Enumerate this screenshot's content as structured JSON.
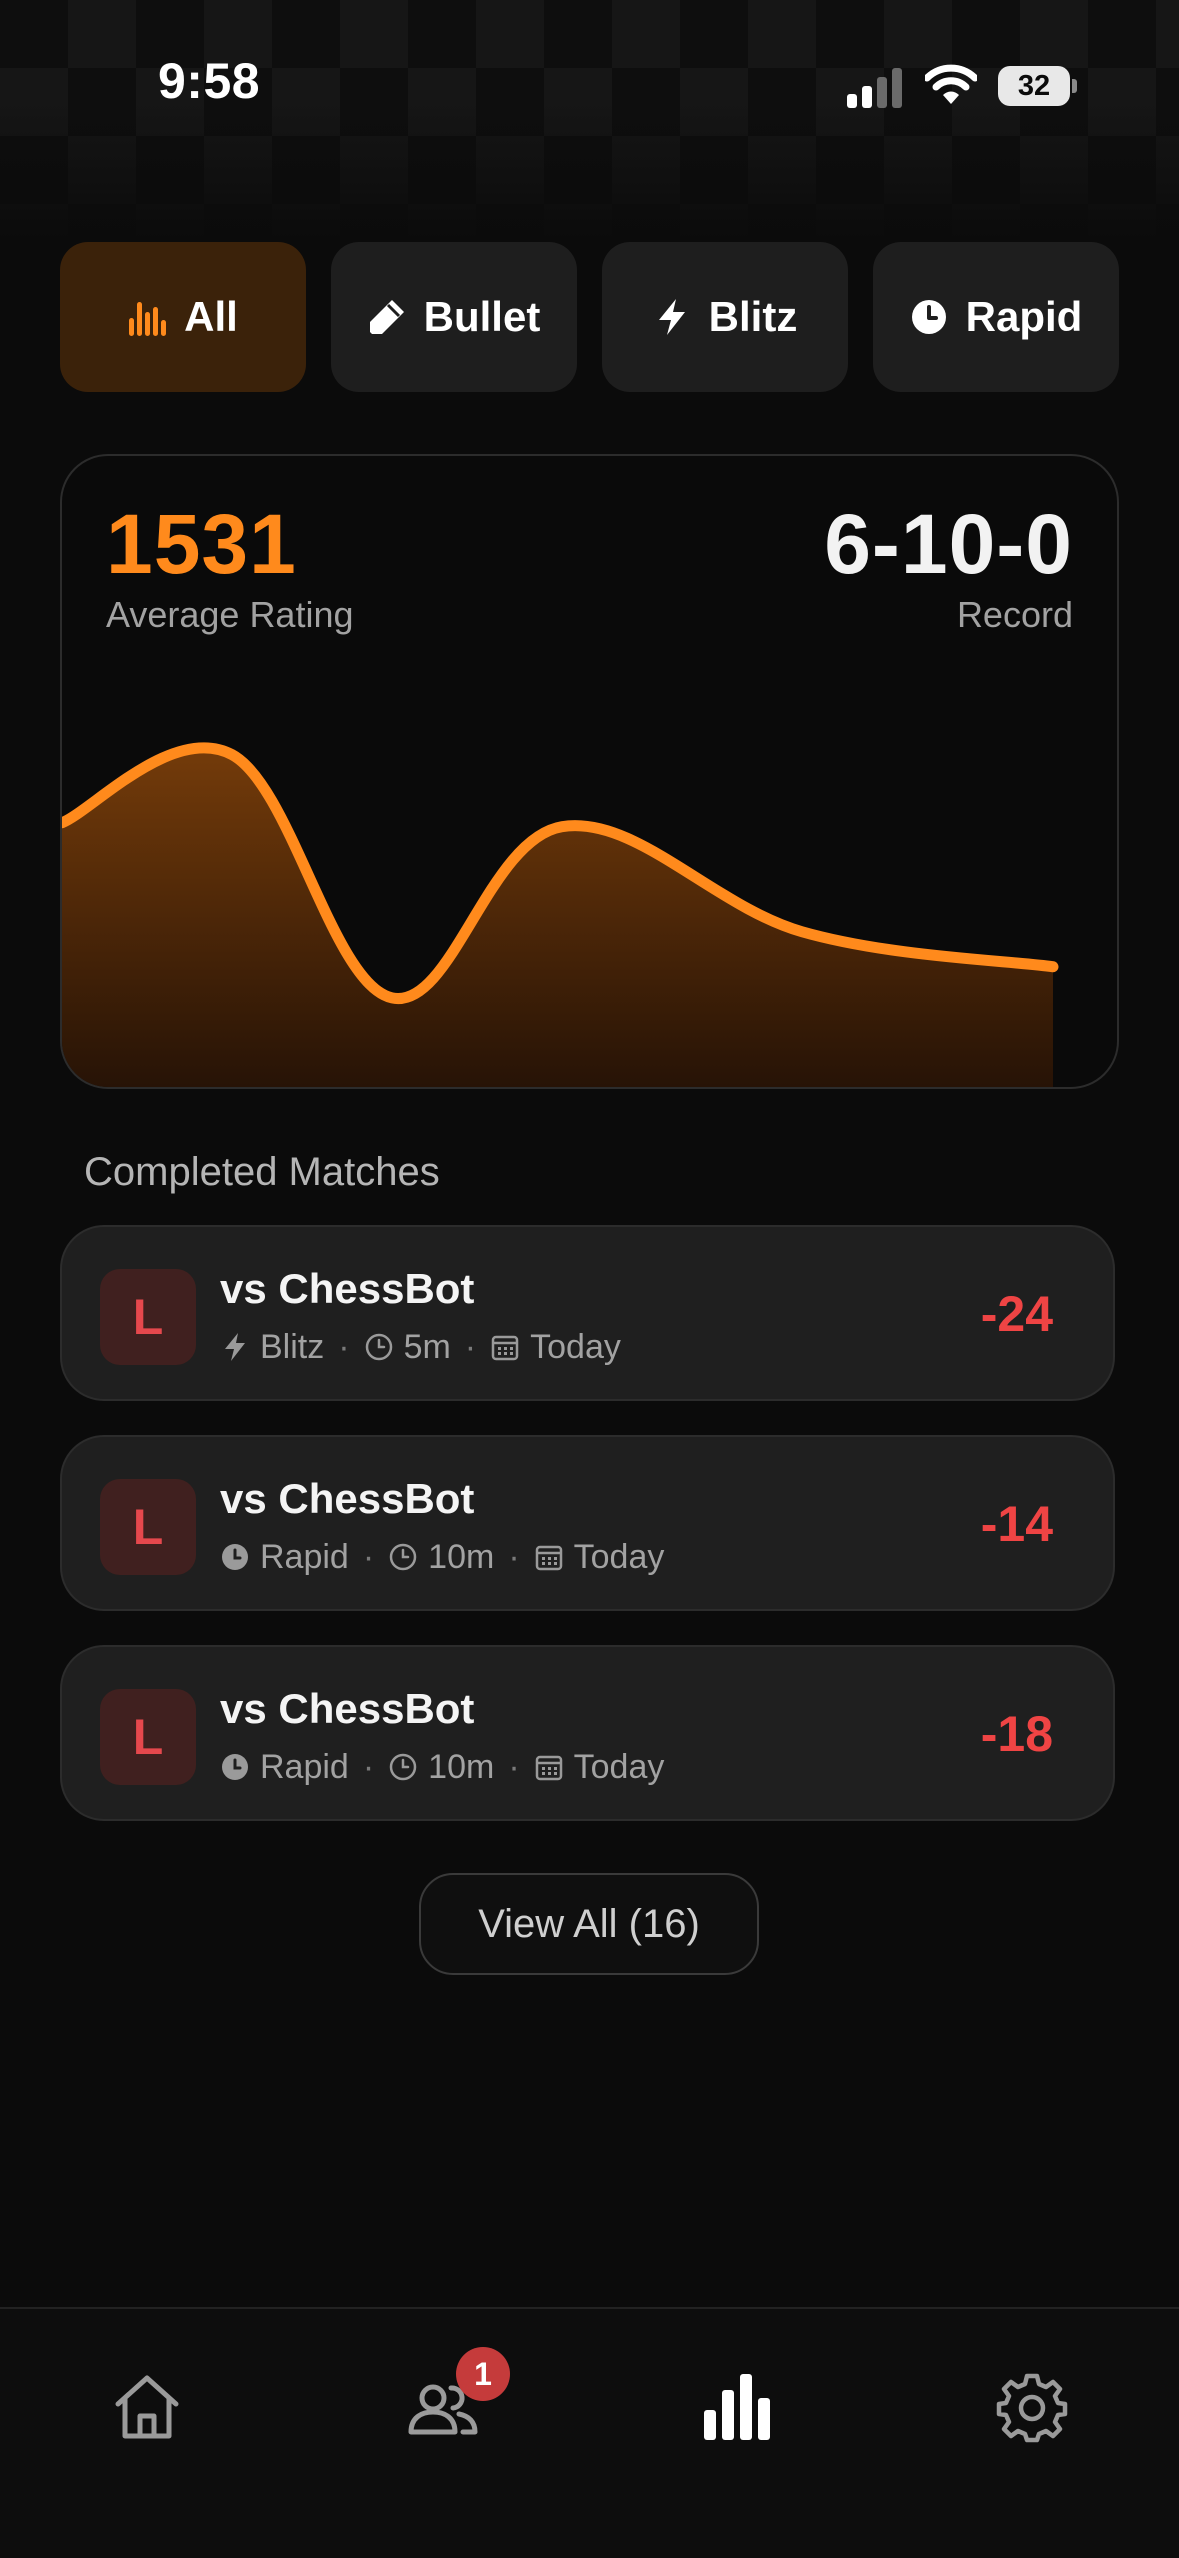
{
  "status_bar": {
    "time": "9:58",
    "battery_level": "32"
  },
  "filters": {
    "selected": "All",
    "tabs": [
      {
        "label": "All",
        "icon": "bar-chart-icon"
      },
      {
        "label": "Bullet",
        "icon": "bullet-icon"
      },
      {
        "label": "Blitz",
        "icon": "lightning-icon"
      },
      {
        "label": "Rapid",
        "icon": "clock-icon"
      }
    ]
  },
  "stats": {
    "average_rating": "1531",
    "average_rating_label": "Average Rating",
    "record": "6-10-0",
    "record_label": "Record"
  },
  "chart_data": {
    "type": "area",
    "title": "",
    "xlabel": "",
    "ylabel": "",
    "grid": false,
    "series": [
      {
        "values": [
          1605,
          1640,
          1515,
          1603,
          1549,
          1531
        ]
      }
    ]
  },
  "matches": {
    "section_title": "Completed Matches",
    "items": [
      {
        "result": "L",
        "opponent": "vs ChessBot",
        "mode": "Blitz",
        "mode_icon": "lightning-icon",
        "duration": "5m",
        "date": "Today",
        "rating_change": "-24"
      },
      {
        "result": "L",
        "opponent": "vs ChessBot",
        "mode": "Rapid",
        "mode_icon": "clock-icon",
        "duration": "10m",
        "date": "Today",
        "rating_change": "-14"
      },
      {
        "result": "L",
        "opponent": "vs ChessBot",
        "mode": "Rapid",
        "mode_icon": "clock-icon",
        "duration": "10m",
        "date": "Today",
        "rating_change": "-18"
      }
    ],
    "view_all_label": "View All (16)"
  },
  "tab_bar": {
    "items": [
      {
        "icon": "home-icon"
      },
      {
        "icon": "friends-icon",
        "badge": "1"
      },
      {
        "icon": "stats-icon",
        "active": true
      },
      {
        "icon": "settings-icon"
      }
    ]
  },
  "colors": {
    "accent": "#ff8a1c",
    "loss": "#ef4444",
    "background": "#0b0b0b",
    "card": "#1f1f1f"
  }
}
